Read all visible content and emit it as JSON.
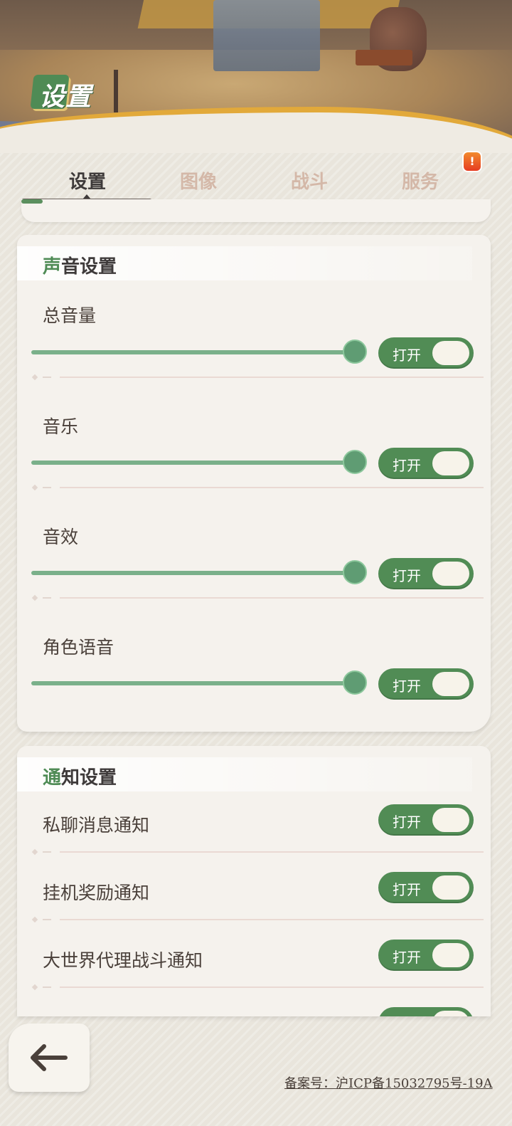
{
  "header": {
    "title": "设置"
  },
  "tabs": [
    {
      "label": "设置",
      "active": true
    },
    {
      "label": "图像",
      "active": false
    },
    {
      "label": "战斗",
      "active": false
    },
    {
      "label": "服务",
      "active": false
    }
  ],
  "notice_badge": "!",
  "sound_settings": {
    "title_first": "声",
    "title_rest": "音设置",
    "rows": [
      {
        "label": "总音量",
        "toggle": "打开",
        "level": 1.0
      },
      {
        "label": "音乐",
        "toggle": "打开",
        "level": 1.0
      },
      {
        "label": "音效",
        "toggle": "打开",
        "level": 1.0
      },
      {
        "label": "角色语音",
        "toggle": "打开",
        "level": 1.0
      }
    ]
  },
  "notify_settings": {
    "title_first": "通",
    "title_rest": "知设置",
    "rows": [
      {
        "label": "私聊消息通知",
        "toggle": "打开"
      },
      {
        "label": "挂机奖励通知",
        "toggle": "打开"
      },
      {
        "label": "大世界代理战斗通知",
        "toggle": "打开"
      }
    ]
  },
  "footer": {
    "icp": "备案号：沪ICP备15032795号-19A"
  },
  "colors": {
    "accent_green": "#518c55",
    "slider_green": "#7ab08a",
    "panel_bg": "#f5f2ed"
  },
  "icons": {
    "back": "back-arrow-icon",
    "notice": "exclamation-icon"
  }
}
